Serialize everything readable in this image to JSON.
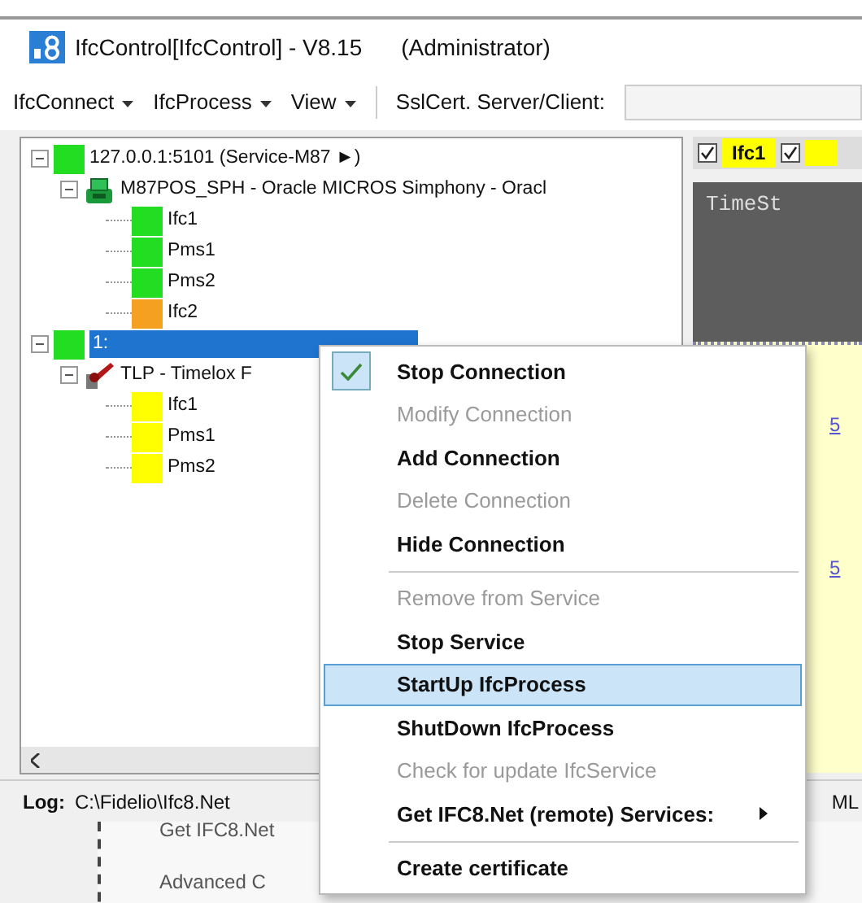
{
  "window": {
    "title": "IfcControl[IfcControl] - V8.15",
    "role": "(Administrator)"
  },
  "menu_bar": [
    "IfcConnect",
    "IfcProcess",
    "View"
  ],
  "toolbar": {
    "label": "SslCert. Server/Client:"
  },
  "tree": [
    {
      "label": "127.0.0.1:5101 (Service-M87 ►)",
      "color": "#22dd22",
      "selected": false,
      "expanded": true,
      "children": [
        {
          "label": "M87POS_SPH - Oracle MICROS Simphony - Oracl",
          "kind": "pos",
          "expanded": true,
          "children": [
            {
              "label": "Ifc1",
              "color": "#22dd22"
            },
            {
              "label": "Pms1",
              "color": "#22dd22"
            },
            {
              "label": "Pms2",
              "color": "#22dd22"
            },
            {
              "label": "Ifc2",
              "color": "#f5a020"
            }
          ]
        }
      ]
    },
    {
      "label": "1:",
      "color": "#22dd22",
      "selected": true,
      "expanded": true,
      "children": [
        {
          "label": "TLP - Timelox F",
          "kind": "lock",
          "expanded": true,
          "children": [
            {
              "label": "Ifc1",
              "color": "#ffff00"
            },
            {
              "label": "Pms1",
              "color": "#ffff00"
            },
            {
              "label": "Pms2",
              "color": "#ffff00"
            }
          ]
        }
      ]
    }
  ],
  "side_panel": {
    "filters": [
      {
        "label": "Ifc1",
        "checked": true
      },
      {
        "checked": true
      }
    ],
    "console_header": "TimeSt",
    "links": [
      "5",
      "5"
    ],
    "log_tail": "ML"
  },
  "log": {
    "label": "Log:",
    "path": "C:\\Fidelio\\Ifc8.Net"
  },
  "background_window": [
    "Get IFC8.Net",
    "Advanced C"
  ],
  "context_menu": [
    {
      "kind": "item",
      "label": "Stop Connection",
      "disabled": false,
      "checked": true,
      "selected": false
    },
    {
      "kind": "item",
      "label": "Modify Connection",
      "disabled": true,
      "checked": false,
      "selected": false
    },
    {
      "kind": "item",
      "label": "Add Connection",
      "disabled": false,
      "checked": false,
      "selected": false
    },
    {
      "kind": "item",
      "label": "Delete Connection",
      "disabled": true,
      "checked": false,
      "selected": false
    },
    {
      "kind": "item",
      "label": "Hide Connection",
      "disabled": false,
      "checked": false,
      "selected": false
    },
    {
      "kind": "separator"
    },
    {
      "kind": "item",
      "label": "Remove from Service",
      "disabled": true,
      "checked": false,
      "selected": false
    },
    {
      "kind": "item",
      "label": "Stop Service",
      "disabled": false,
      "checked": false,
      "selected": false
    },
    {
      "kind": "item",
      "label": "StartUp IfcProcess",
      "disabled": false,
      "checked": false,
      "selected": true
    },
    {
      "kind": "item",
      "label": "ShutDown IfcProcess",
      "disabled": false,
      "checked": false,
      "selected": false
    },
    {
      "kind": "item",
      "label": "Check for update IfcService",
      "disabled": true,
      "checked": false,
      "selected": false
    },
    {
      "kind": "submenu",
      "label": "Get IFC8.Net (remote) Services:",
      "disabled": false,
      "checked": false,
      "selected": false
    },
    {
      "kind": "separator"
    },
    {
      "kind": "item",
      "label": "Create certificate",
      "disabled": false,
      "checked": false,
      "selected": false
    }
  ]
}
